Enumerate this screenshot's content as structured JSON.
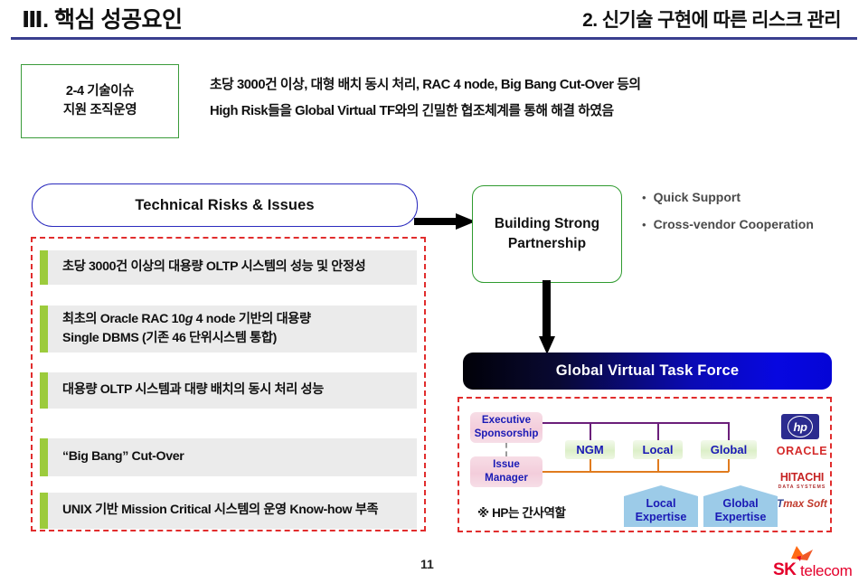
{
  "header": {
    "chapter": "Ⅲ. 핵심 성공요인",
    "section": "2. 신기술 구현에 따른 리스크 관리",
    "rule_color": "#3a3f8f"
  },
  "topic": {
    "box_border_color": "#3a9b3a",
    "line1": "2-4 기술이슈",
    "line2": "지원 조직운영",
    "lead_line1": "초당 3000건 이상, 대형 배치 동시 처리, RAC 4 node, Big Bang Cut-Over 등의",
    "lead_line2": "High Risk들을 Global Virtual TF와의 긴밀한 협조체계를 통해 해결 하였음"
  },
  "risks": {
    "title": "Technical Risks & Issues",
    "title_border_color": "#2b2bbe",
    "panel_border_color": "#e12d2d",
    "accent_color": "#9ccb3c",
    "item_bg": "#ebebeb",
    "items": [
      {
        "text": "초당 3000건 이상의 대용량 OLTP 시스템의 성능 및 안정성"
      },
      {
        "line1": "최초의 Oracle RAC 10",
        "italic": "g",
        "line1b": " 4 node 기반의 대용량",
        "line2": "Single DBMS   (기존 46 단위시스템 통합)"
      },
      {
        "text": "대용량 OLTP 시스템과 대량 배치의 동시 처리 성능"
      },
      {
        "text": "“Big Bang” Cut-Over"
      },
      {
        "text": "UNIX 기반 Mission Critical 시스템의 운영 Know-how 부족"
      }
    ]
  },
  "partnership": {
    "line1": "Building Strong",
    "line2": "Partnership",
    "border_color": "#2f9b2f",
    "bullets": [
      "Quick Support",
      "Cross-vendor Cooperation"
    ],
    "bullet_color": "#4a4a4a"
  },
  "taskforce": {
    "title": "Global Virtual Task Force",
    "gradient_from": "#010108",
    "gradient_to": "#0505d6"
  },
  "org": {
    "panel_border_color": "#e12d2d",
    "exec_sponsorship": {
      "line1": "Executive",
      "line2": "Sponsorship"
    },
    "issue_manager": {
      "line1": "Issue",
      "line2": "Manager"
    },
    "nodes": [
      {
        "label": "NGM"
      },
      {
        "label": "Local"
      },
      {
        "label": "Global"
      }
    ],
    "expertise": [
      {
        "line1": "Local",
        "line2": "Expertise"
      },
      {
        "line1": "Global",
        "line2": "Expertise"
      }
    ],
    "note": "※ HP는 간사역할",
    "line_purple_color": "#6b1f7a",
    "line_orange_color": "#e07b1e",
    "pink_text_color": "#1a1ab5",
    "hex_color": "#9ccbe8"
  },
  "vendors": {
    "hp": "hp",
    "oracle": "ORACLE",
    "hitachi_main": "HITACHI",
    "hitachi_sub": "DATA SYSTEMS",
    "tmax_t": "T",
    "tmax_rest": "max Soft"
  },
  "footer": {
    "page_number": "11",
    "brand_sk": "SK",
    "brand_telecom": "telecom",
    "brand_color": "#e4002b"
  }
}
